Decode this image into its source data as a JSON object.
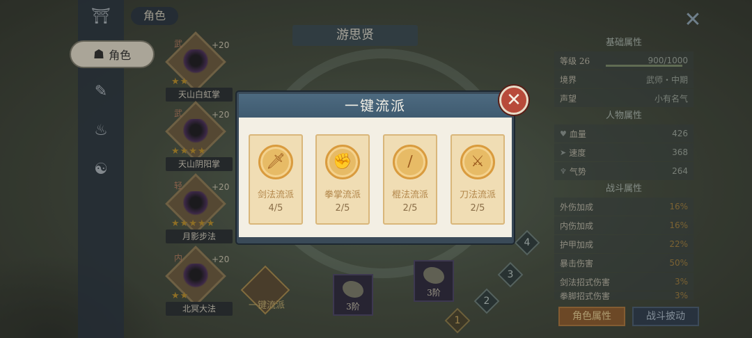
{
  "colors": {
    "modal_header": "#46627a",
    "card_bg": "#f0ddb4",
    "emblem": "#e7bb66",
    "close_button": "#b84a3a",
    "attr_button": "#8a5a2e",
    "battle_button": "#2f3d4e"
  },
  "header": {
    "section_title": "角色",
    "character_name": "游思贤"
  },
  "left_nav": {
    "active_label": "角色"
  },
  "skills": [
    {
      "type": "武",
      "level": "+20",
      "name": "天山白虹掌"
    },
    {
      "type": "武",
      "level": "+20",
      "name": "天山阴阳掌"
    },
    {
      "type": "轻",
      "level": "+20",
      "name": "月影步法"
    },
    {
      "type": "内",
      "level": "+20",
      "name": "北冥大法"
    }
  ],
  "onekey_label": "一键流派",
  "tiers": [
    "3阶",
    "3阶"
  ],
  "levels": [
    "1",
    "2",
    "3",
    "4"
  ],
  "attributes": {
    "base_title": "基础属性",
    "level_label": "等级 26",
    "exp": "900/1000",
    "realm_label": "境界",
    "realm_value": "武师・中期",
    "fame_label": "声望",
    "fame_value": "小有名气",
    "char_title": "人物属性",
    "hp_label": "血量",
    "hp_value": "426",
    "speed_label": "速度",
    "speed_value": "368",
    "aura_label": "气势",
    "aura_value": "264",
    "battle_title": "战斗属性",
    "combat_rows": [
      {
        "label": "外伤加成",
        "value": "16%"
      },
      {
        "label": "内伤加成",
        "value": "16%"
      },
      {
        "label": "护甲加成",
        "value": "22%"
      },
      {
        "label": "暴击伤害",
        "value": "50%"
      },
      {
        "label": "剑法招式伤害",
        "value": "3%"
      },
      {
        "label": "拳脚招式伤害",
        "value": "3%"
      }
    ]
  },
  "buttons": {
    "attr": "角色属性",
    "battle": "战斗披动"
  },
  "modal": {
    "title": "一键流派",
    "cards": [
      {
        "label": "剑法流派",
        "count": "4/5",
        "icon": "sword-icon"
      },
      {
        "label": "拳掌流派",
        "count": "2/5",
        "icon": "fist-icon"
      },
      {
        "label": "棍法流派",
        "count": "2/5",
        "icon": "staff-icon"
      },
      {
        "label": "刀法流派",
        "count": "2/5",
        "icon": "blade-icon"
      }
    ]
  }
}
